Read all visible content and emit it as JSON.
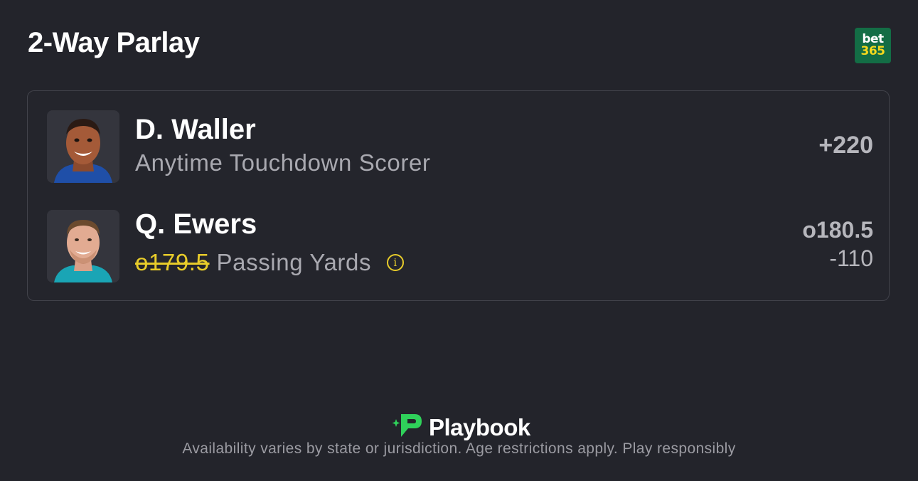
{
  "header": {
    "title": "2-Way Parlay",
    "sportsbook_logo_line1": "bet",
    "sportsbook_logo_line2": "365"
  },
  "legs": [
    {
      "player": "D. Waller",
      "market": "Anytime Touchdown Scorer",
      "odds": "+220",
      "avatar_icon": "player-headshot-icon"
    },
    {
      "player": "Q. Ewers",
      "old_line": "o179.5",
      "market": "Passing Yards",
      "line": "o180.5",
      "price": "-110",
      "info_icon_glyph": "i",
      "avatar_icon": "player-headshot-icon"
    }
  ],
  "footer": {
    "brand": "Playbook",
    "disclaimer": "Availability varies by state or jurisdiction. Age restrictions apply. Play responsibly"
  },
  "colors": {
    "background": "#23242b",
    "card_border": "#42434b",
    "accent_yellow": "#e8cc2a",
    "brand_green": "#2fd15a",
    "bet365_green": "#136d45"
  }
}
